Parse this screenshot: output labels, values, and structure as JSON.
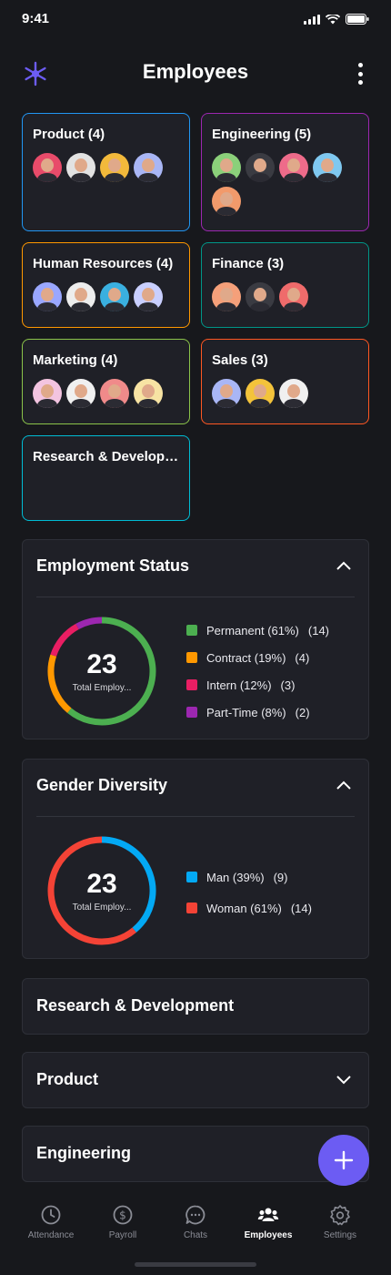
{
  "status_bar": {
    "time": "9:41"
  },
  "header": {
    "title": "Employees"
  },
  "departments": [
    {
      "name": "Product (4)",
      "color": "#2196f3",
      "avatar_colors": [
        "#e84b6a",
        "#e2e2e2",
        "#f2b93b",
        "#a9b6f5"
      ]
    },
    {
      "name": "Engineering (5)",
      "color": "#9c27b0",
      "avatar_colors": [
        "#8bd07a",
        "#3a3b42",
        "#ee6b8a",
        "#7fc8f0",
        "#f29a6b"
      ]
    },
    {
      "name": "Human Resources (4)",
      "color": "#ff9800",
      "avatar_colors": [
        "#9aa7ff",
        "#ededed",
        "#3ab0e0",
        "#c9cfff"
      ]
    },
    {
      "name": "Finance (3)",
      "color": "#009688",
      "avatar_colors": [
        "#f5a07a",
        "#3a3b42",
        "#ef6b6b"
      ]
    },
    {
      "name": "Marketing (4)",
      "color": "#8bc34a",
      "avatar_colors": [
        "#f3c4e0",
        "#f0f0f0",
        "#f08a8a",
        "#f7e3a3"
      ]
    },
    {
      "name": "Sales (3)",
      "color": "#ff5722",
      "avatar_colors": [
        "#a9b6f5",
        "#f3c33b",
        "#f0f0f0"
      ]
    },
    {
      "name": "Research & Development",
      "color": "#00bcd4",
      "avatar_colors": []
    }
  ],
  "employment_status": {
    "title": "Employment Status",
    "total": "23",
    "total_label": "Total Employ...",
    "items": [
      {
        "label": "Permanent (61%)",
        "count": "(14)",
        "color": "#4caf50",
        "value": 61
      },
      {
        "label": "Contract (19%)",
        "count": "(4)",
        "color": "#ff9800",
        "value": 19
      },
      {
        "label": "Intern (12%)",
        "count": "(3)",
        "color": "#e91e63",
        "value": 12
      },
      {
        "label": "Part-Time (8%)",
        "count": "(2)",
        "color": "#9c27b0",
        "value": 8
      }
    ]
  },
  "gender_diversity": {
    "title": "Gender Diversity",
    "total": "23",
    "total_label": "Total Employ...",
    "items": [
      {
        "label": "Man (39%)",
        "count": "(9)",
        "color": "#03a9f4",
        "value": 39
      },
      {
        "label": "Woman (61%)",
        "count": "(14)",
        "color": "#f44336",
        "value": 61
      }
    ]
  },
  "sections": [
    {
      "title": "Research & Development"
    },
    {
      "title": "Product"
    },
    {
      "title": "Engineering"
    }
  ],
  "tabs": [
    {
      "label": "Attendance",
      "icon": "clock-icon"
    },
    {
      "label": "Payroll",
      "icon": "dollar-icon"
    },
    {
      "label": "Chats",
      "icon": "chat-icon"
    },
    {
      "label": "Employees",
      "icon": "people-icon"
    },
    {
      "label": "Settings",
      "icon": "gear-icon"
    }
  ],
  "colors": {
    "accent": "#6c5cf3",
    "background": "#17181c",
    "card": "#1f2027"
  }
}
